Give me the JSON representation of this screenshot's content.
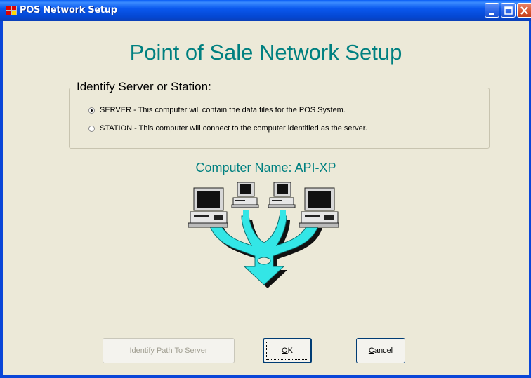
{
  "window": {
    "title": "POS Network Setup",
    "controls": [
      "minimize",
      "maximize",
      "close"
    ]
  },
  "main": {
    "heading": "Point of Sale Network Setup",
    "group": {
      "legend": "Identify Server or Station:",
      "options": [
        {
          "label": "SERVER - This computer will contain the data files for the  POS System.",
          "checked": true
        },
        {
          "label": "STATION - This computer will connect to the computer identified as the server.",
          "checked": false
        }
      ]
    },
    "computer_name": "Computer Name: API-XP",
    "network_diagram_icon": "network-computers-icon"
  },
  "buttons": {
    "identify_path": "Identify Path To Server",
    "ok_mnemonic": "O",
    "ok_rest": "K",
    "cancel_mnemonic": "C",
    "cancel_rest": "ancel"
  },
  "colors": {
    "accent_teal": "#008080",
    "network_cyan": "#33e6e6",
    "dialog_bg": "#ece9d8",
    "titlebar_blue": "#0a58ee"
  }
}
